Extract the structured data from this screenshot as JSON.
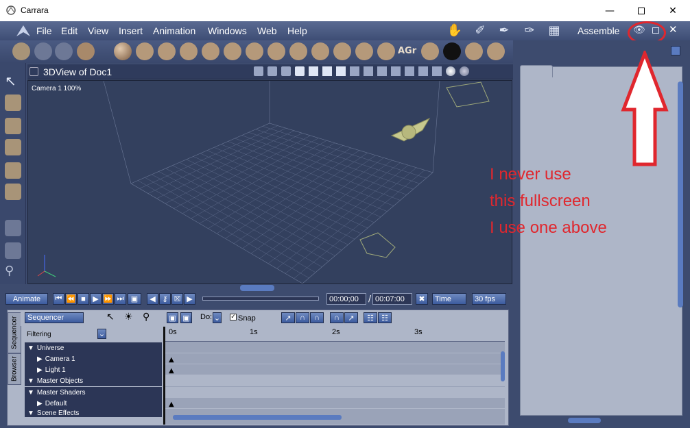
{
  "window": {
    "title": "Carrara"
  },
  "menu": {
    "items": [
      "File",
      "Edit",
      "View",
      "Insert",
      "Animation",
      "Windows",
      "Web",
      "Help"
    ],
    "room_label": "Assemble"
  },
  "view": {
    "title": "3DView of Doc1",
    "camera_label": "Camera 1 100%"
  },
  "animation": {
    "animate_label": "Animate",
    "current_time": "00:00;00",
    "end_time": "00:07:00",
    "time_mode": "Time",
    "fps": "30 fps"
  },
  "sequencer": {
    "mode": "Sequencer",
    "filter_label": "Filtering",
    "do_label": "Do:",
    "snap_label": "Snap",
    "tabs": [
      "Sequencer",
      "Browser"
    ],
    "ruler": [
      "0s",
      "1s",
      "2s",
      "3s"
    ],
    "tree": [
      "Universe",
      "Camera 1",
      "Light 1",
      "Master Objects",
      "Master Shaders",
      "Default",
      "Scene Effects"
    ]
  },
  "annotation": {
    "text": "I never use\nthis fullscreen\nI use one above"
  },
  "colors": {
    "annotation": "#e0272e",
    "accent": "#5a7bc0"
  }
}
